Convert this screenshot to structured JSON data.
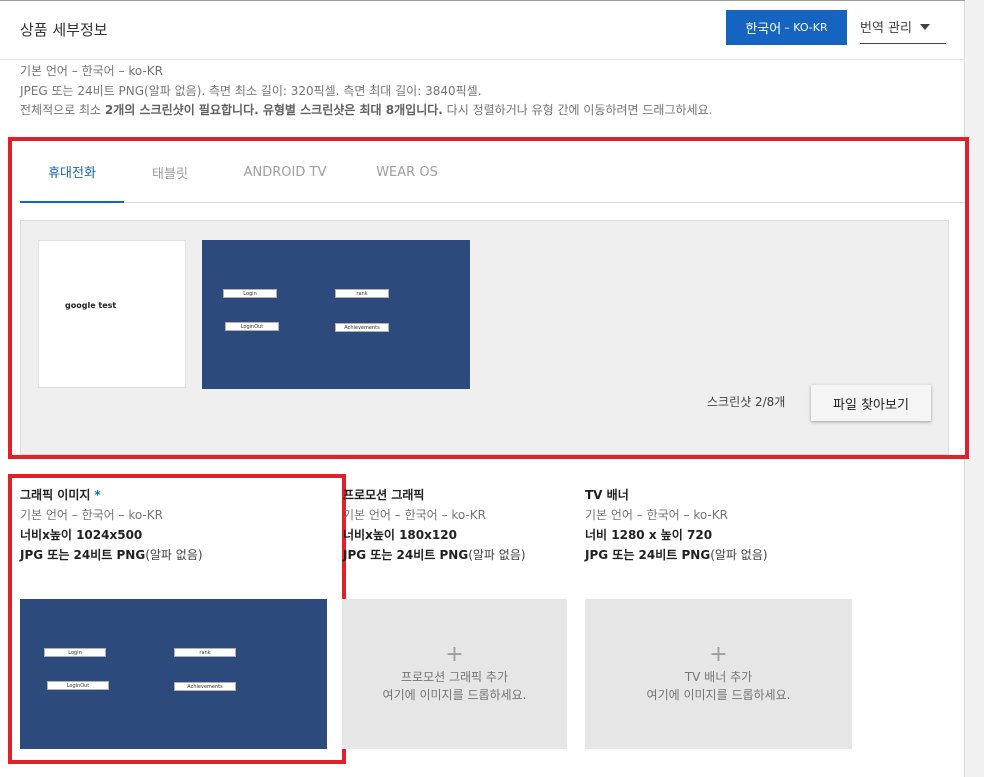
{
  "header": {
    "title": "상품 세부정보",
    "language_button": "한국어",
    "language_code": "– KO-KR",
    "translation_menu": "번역 관리"
  },
  "info": {
    "line1": "기본 언어 – 한국어 – ko-KR",
    "line2": "JPEG 또는 24비트 PNG(알파 없음). 측면 최소 길이: 320픽셀. 측면 최대 길이: 3840픽셀.",
    "line3_pre": "전체적으로 최소 ",
    "line3_bold1": "2개의 스크린샷이 필요합니다. 유형별 스크린샷은 최대 8개입니다.",
    "line3_post": " 다시 정렬하거나 유형 간에 이동하려면 드래그하세요."
  },
  "tabs": [
    "휴대전화",
    "태블릿",
    "ANDROID TV",
    "WEAR OS"
  ],
  "screenshots": {
    "thumb1_text": "google test",
    "game_buttons": [
      "Login",
      "rank",
      "LoginOut",
      "Achievements"
    ],
    "count": "스크린샷 2/8개",
    "browse_label": "파일 찾아보기"
  },
  "graphic": {
    "title": "그래픽 이미지",
    "required": "*",
    "lang": "기본 언어 – 한국어 – ko-KR",
    "size": "너비x높이 1024x500",
    "format_bold": "JPG 또는 24비트 PNG",
    "format_rest": "(알파 없음)"
  },
  "promo": {
    "title": "프로모션 그래픽",
    "lang": "기본 언어 – 한국어 – ko-KR",
    "size": "너비x높이 180x120",
    "format_bold": "JPG 또는 24비트 PNG",
    "format_rest": "(알파 없음)",
    "plus": "+",
    "add": "프로모션 그래픽 추가",
    "drop": "여기에 이미지를 드롭하세요."
  },
  "tv": {
    "title": "TV 배너",
    "lang": "기본 언어 – 한국어 – ko-KR",
    "size": "너비 1280 x 높이 720",
    "format_bold": "JPG 또는 24비트 PNG",
    "format_rest": "(알파 없음)",
    "plus": "+",
    "add": "TV 배너 추가",
    "drop": "여기에 이미지를 드롭하세요."
  },
  "colors": {
    "accent": "#1565c0",
    "highlight": "#e3202a",
    "game_bg": "#2d4a7c"
  }
}
